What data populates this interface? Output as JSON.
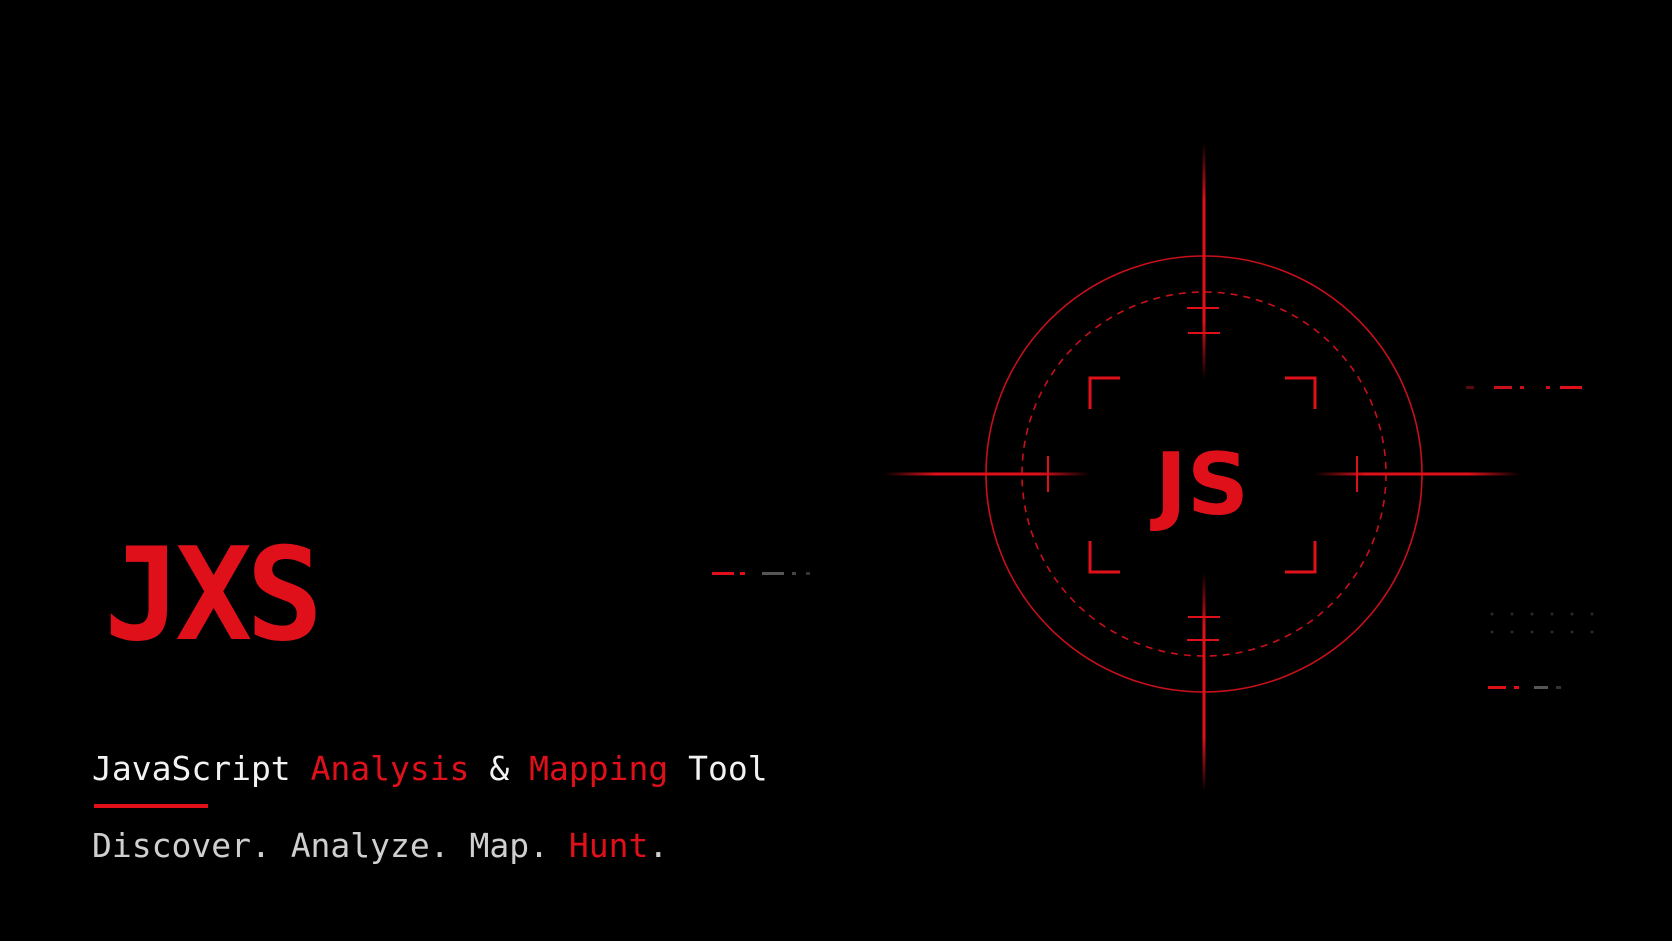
{
  "brand": {
    "logo_text": "JXS"
  },
  "tagline": {
    "part1": "JavaScript",
    "part2": "Analysis",
    "part3": "&",
    "part4": "Mapping",
    "part5": "Tool"
  },
  "slogan": {
    "discover": "Discover.",
    "analyze": "Analyze.",
    "map": "Map.",
    "hunt": "Hunt",
    "hunt_period": "."
  },
  "scope": {
    "center_text": "JS"
  },
  "colors": {
    "background": "#000000",
    "accent": "#e0101a",
    "text_primary": "#f2f2f2",
    "text_secondary": "#cfcfcf"
  },
  "icons": {
    "target": "crosshair-target-icon"
  }
}
